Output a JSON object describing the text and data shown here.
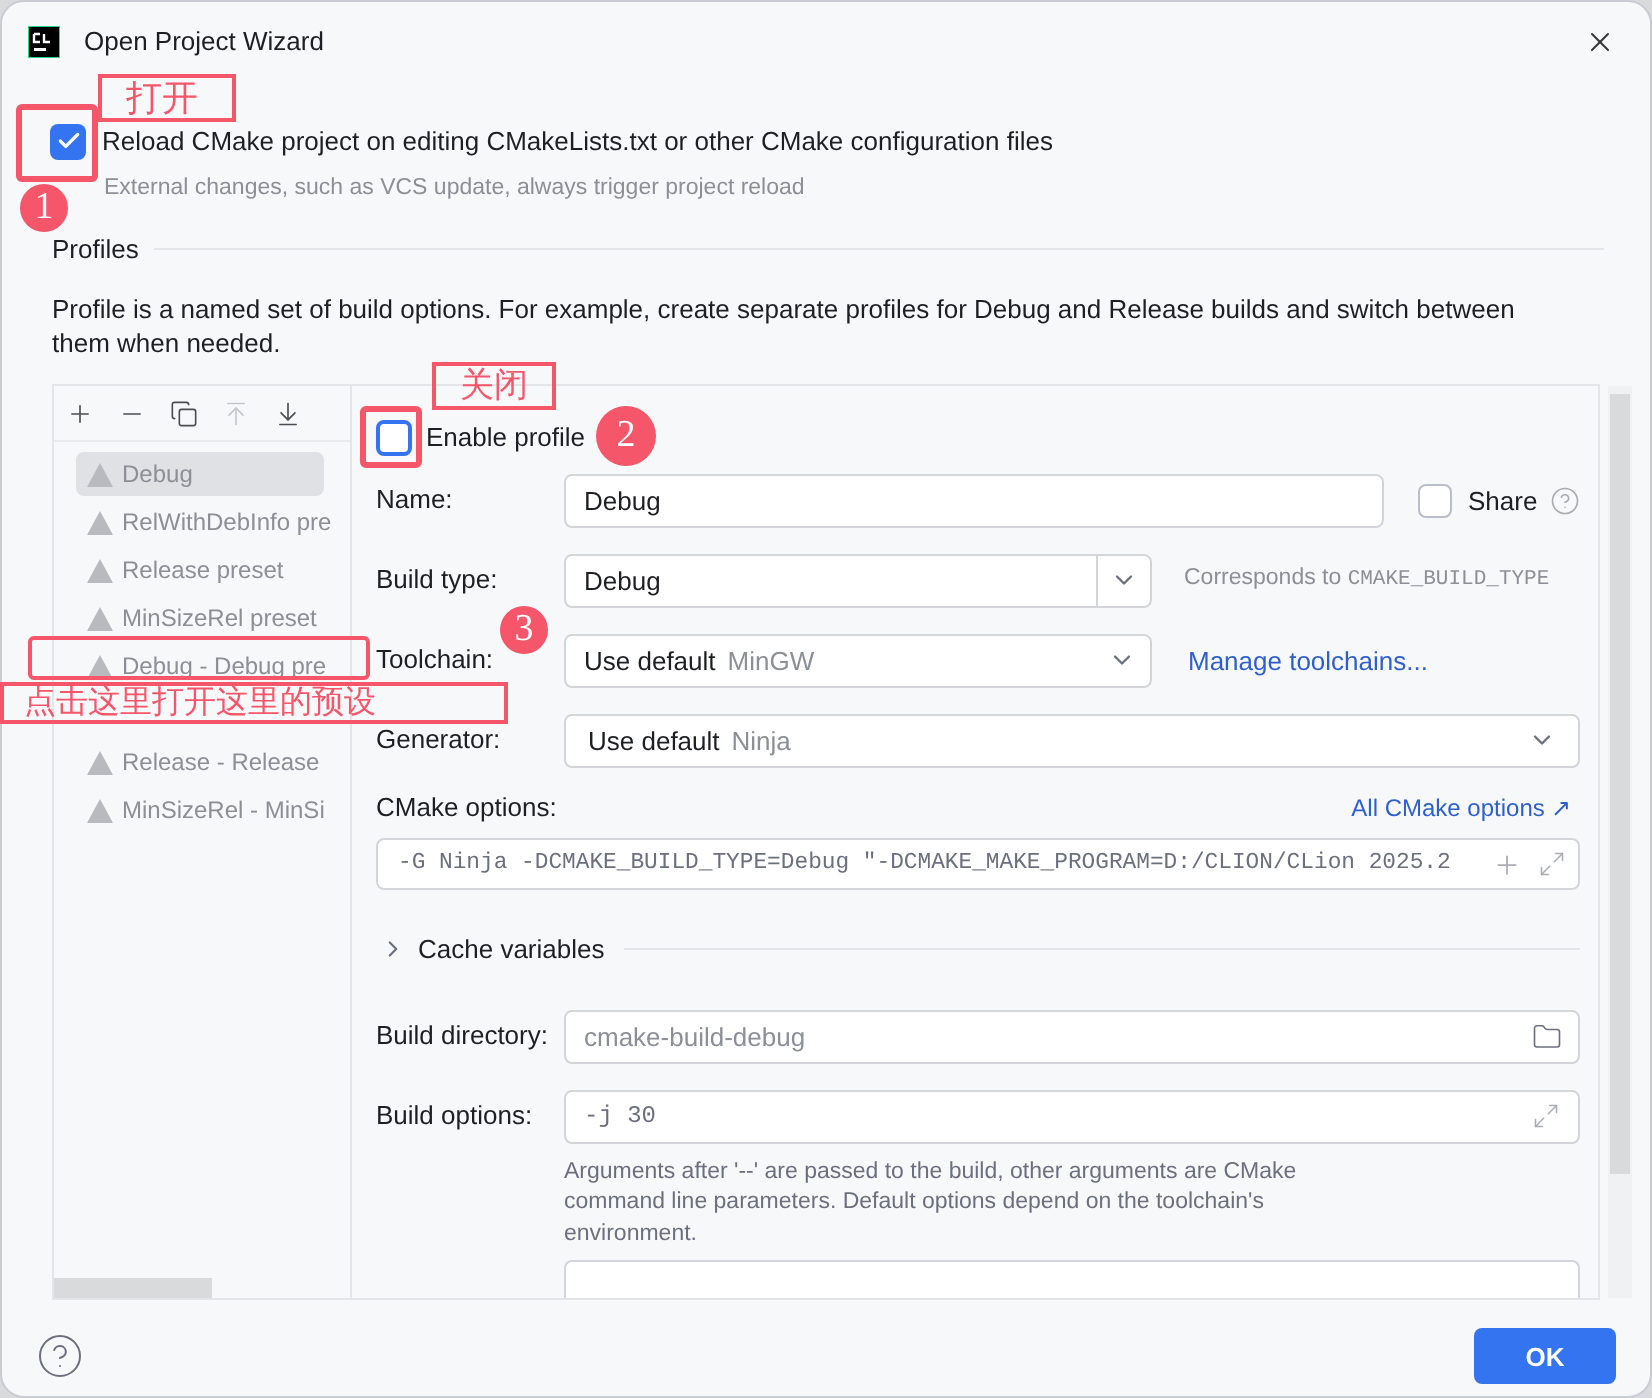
{
  "window": {
    "title": "Open Project Wizard"
  },
  "reload": {
    "label": "Reload CMake project on editing CMakeLists.txt or other CMake configuration files",
    "hint": "External changes, such as VCS update, always trigger project reload",
    "checked": true
  },
  "profiles": {
    "heading": "Profiles",
    "description": "Profile is a named set of build options. For example, create separate profiles for Debug and Release builds and switch between them when needed."
  },
  "toolbar": [
    {
      "kind": "add",
      "disabled": false
    },
    {
      "kind": "remove",
      "disabled": false
    },
    {
      "kind": "copy",
      "disabled": false
    },
    {
      "kind": "up",
      "disabled": true
    },
    {
      "kind": "down",
      "disabled": false
    }
  ],
  "profile_list": [
    {
      "kind": "profile",
      "label": "Debug",
      "selected": true
    },
    {
      "kind": "profile",
      "label": "RelWithDebInfo pre",
      "selected": false
    },
    {
      "kind": "profile",
      "label": "Release preset",
      "selected": false
    },
    {
      "kind": "profile",
      "label": "MinSizeRel preset",
      "selected": false
    },
    {
      "kind": "profile",
      "label": "Debug - Debug pre",
      "selected": false
    },
    {
      "kind": "covered"
    },
    {
      "kind": "profile",
      "label": "Release - Release",
      "selected": false
    },
    {
      "kind": "profile",
      "label": "MinSizeRel - MinSi",
      "selected": false
    }
  ],
  "form": {
    "enable_profile": {
      "label": "Enable profile",
      "checked": false
    },
    "name": {
      "label": "Name:",
      "value": "Debug"
    },
    "share": {
      "label": "Share",
      "checked": false
    },
    "build_type": {
      "label": "Build type:",
      "value": "Debug",
      "note": "Corresponds to",
      "note_code": "CMAKE_BUILD_TYPE"
    },
    "toolchain": {
      "label": "Toolchain:",
      "value": "Use default",
      "detail": "MinGW",
      "link": "Manage toolchains..."
    },
    "generator": {
      "label": "Generator:",
      "value": "Use default",
      "detail": "Ninja"
    },
    "cmake_options": {
      "label": "CMake options:",
      "link": "All CMake options ↗",
      "value": "-G Ninja -DCMAKE_BUILD_TYPE=Debug \"-DCMAKE_MAKE_PROGRAM=D:/CLION/CLion 2025.2"
    },
    "cache_variables": {
      "label": "Cache variables",
      "expanded": false
    },
    "build_directory": {
      "label": "Build directory:",
      "placeholder": "cmake-build-debug"
    },
    "build_options": {
      "label": "Build options:",
      "value": "-j 30",
      "hint": "Arguments after '--' are passed to the build, other arguments are CMake command line parameters. Default options depend on the toolchain's environment."
    }
  },
  "ok_button": "OK",
  "annotations": {
    "labels": [
      "打开",
      "关闭",
      "点击这里打开这里的预设"
    ],
    "badges": [
      "1",
      "2",
      "3"
    ]
  }
}
